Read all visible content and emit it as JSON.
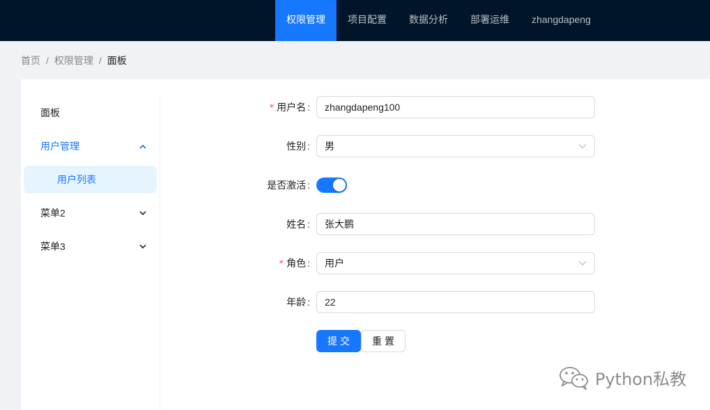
{
  "header": {
    "nav": [
      {
        "label": "权限管理",
        "active": true
      },
      {
        "label": "项目配置"
      },
      {
        "label": "数据分析"
      },
      {
        "label": "部署运维"
      },
      {
        "label": "zhangdapeng"
      }
    ]
  },
  "breadcrumb": {
    "items": [
      "首页",
      "权限管理",
      "面板"
    ],
    "separator": "/"
  },
  "sidebar": {
    "items": [
      {
        "label": "面板"
      },
      {
        "label": "用户管理",
        "icon": "chevron-up-icon"
      },
      {
        "label": "用户列表",
        "selected": true
      },
      {
        "label": "菜单2",
        "icon": "chevron-down-icon"
      },
      {
        "label": "菜单3",
        "icon": "chevron-down-icon"
      }
    ]
  },
  "form": {
    "username": {
      "label": "用户名",
      "value": "zhangdapeng100",
      "required": true
    },
    "gender": {
      "label": "性别",
      "value": "男"
    },
    "active": {
      "label": "是否激活",
      "checked": true
    },
    "name": {
      "label": "姓名",
      "value": "张大鹏"
    },
    "role": {
      "label": "角色",
      "value": "用户",
      "required": true
    },
    "age": {
      "label": "年龄",
      "value": "22"
    },
    "required_mark": "*",
    "colon": ":",
    "submit_label": "提交",
    "reset_label": "重置"
  },
  "watermark": {
    "text": "Python私教"
  },
  "colors": {
    "header_bg": "#001529",
    "primary": "#1677ff",
    "required": "#ff4d4f",
    "menu_selected_bg": "#e6f4ff"
  }
}
